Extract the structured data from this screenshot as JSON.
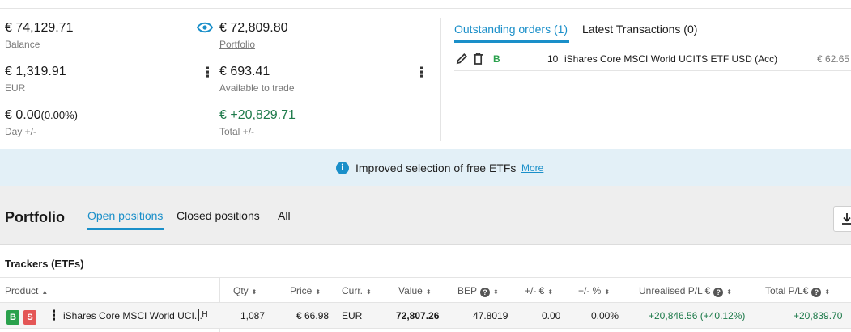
{
  "summary": {
    "balance": {
      "value": "€ 74,129.71",
      "label": "Balance"
    },
    "portfolio": {
      "value": "€ 72,809.80",
      "label": "Portfolio"
    },
    "eur": {
      "value": "€ 1,319.91",
      "label": "EUR"
    },
    "available": {
      "value": "€ 693.41",
      "label": "Available to trade"
    },
    "day": {
      "value": "€ 0.00",
      "pct": "(0.00%)",
      "label": "Day +/-"
    },
    "total": {
      "value": "€ +20,829.71",
      "label": "Total +/-"
    }
  },
  "orders": {
    "tabs": [
      "Outstanding orders (1)",
      "Latest Transactions (0)"
    ],
    "row": {
      "side": "B",
      "qty": "10",
      "product": "iShares Core MSCI World UCITS ETF USD (Acc)",
      "price": "€ 62.65"
    }
  },
  "banner": {
    "message": "Improved selection of free ETFs",
    "link": "More"
  },
  "portfolio": {
    "title": "Portfolio",
    "tabs": [
      "Open positions",
      "Closed positions",
      "All"
    ],
    "section": "Trackers (ETFs)",
    "columns": {
      "product": "Product",
      "qty": "Qty",
      "price": "Price",
      "curr": "Curr.",
      "value": "Value",
      "bep": "BEP",
      "chg_eur": "+/- €",
      "chg_pct": "+/- %",
      "unrealised": "Unrealised P/L €",
      "total": "Total P/L€"
    },
    "rows": [
      {
        "buy": "B",
        "sell": "S",
        "product": "iShares Core MSCI World UCI...",
        "hedge": "H",
        "qty": "1,087",
        "price": "€ 66.98",
        "curr": "EUR",
        "value": "72,807.26",
        "bep": "47.8019",
        "chg_eur": "0.00",
        "chg_pct": "0.00%",
        "unrealised": "+20,846.56 (+40.12%)",
        "total": "+20,839.70"
      }
    ]
  },
  "colors": {
    "accent": "#1a8fc9",
    "positive": "#1d7a4a",
    "buy": "#2aa14c",
    "sell": "#e45656"
  }
}
